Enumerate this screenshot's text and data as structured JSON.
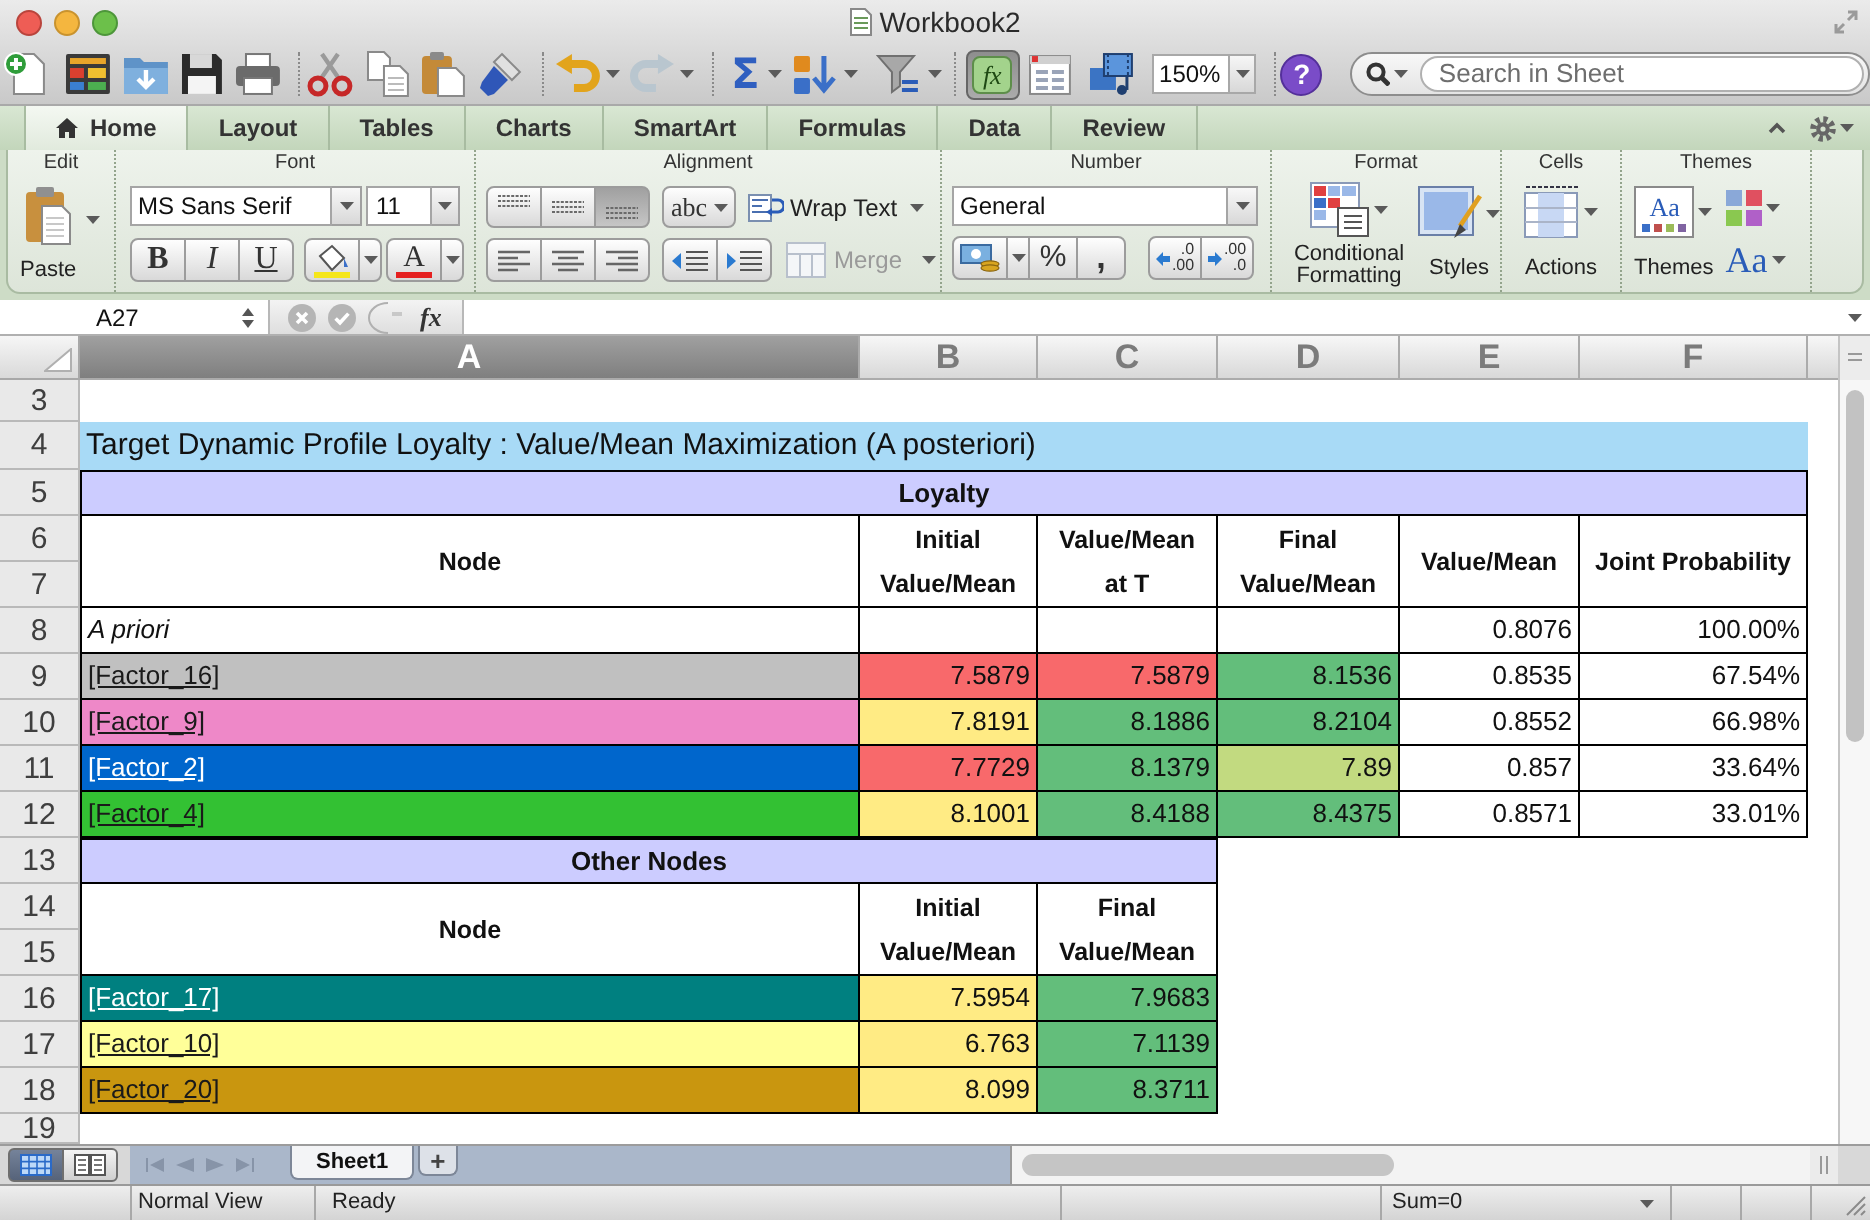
{
  "window": {
    "title": "Workbook2"
  },
  "toolbar": {
    "history": [
      {
        "kind": "undo",
        "disabled": false
      },
      {
        "kind": "redo",
        "disabled": true
      }
    ],
    "autosum": "Σ",
    "formula_builder": {
      "label": "fx",
      "selected": true
    },
    "zoom": "150%",
    "help": "?",
    "search": {
      "placeholder": "Search in Sheet"
    }
  },
  "tabs": [
    {
      "label": "Home",
      "selected": true
    },
    {
      "label": "Layout",
      "selected": false
    },
    {
      "label": "Tables",
      "selected": false
    },
    {
      "label": "Charts",
      "selected": false
    },
    {
      "label": "SmartArt",
      "selected": false
    },
    {
      "label": "Formulas",
      "selected": false
    },
    {
      "label": "Data",
      "selected": false
    },
    {
      "label": "Review",
      "selected": false
    }
  ],
  "ribbon": {
    "edit": {
      "title": "Edit",
      "paste": "Paste"
    },
    "font": {
      "title": "Font",
      "name": "MS Sans Serif",
      "size": "11",
      "styles": [
        {
          "kind": "bold",
          "label": "B"
        },
        {
          "kind": "italic",
          "label": "I"
        },
        {
          "kind": "underline",
          "label": "U"
        }
      ],
      "font_color": "A"
    },
    "alignment": {
      "title": "Alignment",
      "vertical": [
        {
          "kind": "top",
          "selected": false
        },
        {
          "kind": "middle",
          "selected": false
        },
        {
          "kind": "bottom",
          "selected": true
        }
      ],
      "horizontal": [
        {
          "kind": "left",
          "selected": false
        },
        {
          "kind": "center",
          "selected": false
        },
        {
          "kind": "right",
          "selected": false
        }
      ],
      "orientation": "abc",
      "wrap_text": "Wrap Text",
      "merge": {
        "label": "Merge",
        "disabled": true
      }
    },
    "number": {
      "title": "Number",
      "format": "General",
      "percent": "%",
      "comma": ",",
      "decimals": [
        {
          "kind": "increase",
          "top": ".0",
          "bottom": ".00"
        },
        {
          "kind": "decrease",
          "top": ".00",
          "bottom": ".0"
        }
      ]
    },
    "format": {
      "title": "Format",
      "conditional_formatting": "Conditional Formatting",
      "styles": "Styles"
    },
    "cells": {
      "title": "Cells",
      "actions": "Actions"
    },
    "themes": {
      "title": "Themes",
      "thumbnail": "Aa",
      "themes": "Themes",
      "fonts": "Aa"
    }
  },
  "formula_bar": {
    "name_box": "A27",
    "fx": "fx"
  },
  "sheet": {
    "columns": [
      {
        "label": "A",
        "selected": true
      },
      {
        "label": "B",
        "selected": false
      },
      {
        "label": "C",
        "selected": false
      },
      {
        "label": "D",
        "selected": false
      },
      {
        "label": "E",
        "selected": false
      },
      {
        "label": "F",
        "selected": false
      }
    ],
    "rows": [
      "3",
      "4",
      "5",
      "6",
      "7",
      "8",
      "9",
      "10",
      "11",
      "12",
      "13",
      "14",
      "15",
      "16",
      "17",
      "18",
      "19"
    ],
    "title": "Target Dynamic Profile Loyalty : Value/Mean Maximization (A posteriori)",
    "tables": [
      {
        "caption": "Loyalty",
        "headers": [
          "Node",
          "Initial Value/Mean",
          "Value/Mean at T",
          "Final Value/Mean",
          "Value/Mean",
          "Joint Probability"
        ],
        "rows": [
          {
            "kind": "prior",
            "node": "A priori",
            "values": [
              {
                "kind": "empty"
              },
              {
                "kind": "empty"
              },
              {
                "kind": "empty"
              },
              {
                "kind": "value",
                "text": "0.8076"
              },
              {
                "kind": "value",
                "text": "100.00%"
              }
            ]
          },
          {
            "kind": "node",
            "node": "[Factor_16]",
            "color": "#c0c0c0",
            "values": [
              {
                "kind": "value",
                "text": "7.5879",
                "color": "#f8696b"
              },
              {
                "kind": "value",
                "text": "7.5879",
                "color": "#f8696b"
              },
              {
                "kind": "value",
                "text": "8.1536",
                "color": "#63be7b"
              },
              {
                "kind": "value",
                "text": "0.8535"
              },
              {
                "kind": "value",
                "text": "67.54%"
              }
            ]
          },
          {
            "kind": "node",
            "node": "[Factor_9]",
            "color": "#ee88c8",
            "values": [
              {
                "kind": "value",
                "text": "7.8191",
                "color": "#ffeb84"
              },
              {
                "kind": "value",
                "text": "8.1886",
                "color": "#63be7b"
              },
              {
                "kind": "value",
                "text": "8.2104",
                "color": "#63be7b"
              },
              {
                "kind": "value",
                "text": "0.8552"
              },
              {
                "kind": "value",
                "text": "66.98%"
              }
            ]
          },
          {
            "kind": "node",
            "node": "[Factor_2]",
            "color": "#0066cc",
            "values": [
              {
                "kind": "value",
                "text": "7.7729",
                "color": "#f8696b"
              },
              {
                "kind": "value",
                "text": "8.1379",
                "color": "#63be7b"
              },
              {
                "kind": "value",
                "text": "7.89",
                "color": "#c2da80"
              },
              {
                "kind": "value",
                "text": "0.857"
              },
              {
                "kind": "value",
                "text": "33.64%"
              }
            ]
          },
          {
            "kind": "node",
            "node": "[Factor_4]",
            "color": "#33c133",
            "values": [
              {
                "kind": "value",
                "text": "8.1001",
                "color": "#ffeb84"
              },
              {
                "kind": "value",
                "text": "8.4188",
                "color": "#63be7b"
              },
              {
                "kind": "value",
                "text": "8.4375",
                "color": "#63be7b"
              },
              {
                "kind": "value",
                "text": "0.8571"
              },
              {
                "kind": "value",
                "text": "33.01%"
              }
            ]
          }
        ]
      },
      {
        "caption": "Other Nodes",
        "headers": [
          "Node",
          "Initial Value/Mean",
          "Final Value/Mean"
        ],
        "rows": [
          {
            "kind": "node",
            "node": "[Factor_17]",
            "color": "#008080",
            "values": [
              {
                "kind": "value",
                "text": "7.5954",
                "color": "#ffeb84"
              },
              {
                "kind": "value",
                "text": "7.9683",
                "color": "#63be7b"
              }
            ]
          },
          {
            "kind": "node",
            "node": "[Factor_10]",
            "color": "#ffff99",
            "values": [
              {
                "kind": "value",
                "text": "6.763",
                "color": "#ffeb84"
              },
              {
                "kind": "value",
                "text": "7.1139",
                "color": "#63be7b"
              }
            ]
          },
          {
            "kind": "node",
            "node": "[Factor_20]",
            "color": "#c9960f",
            "values": [
              {
                "kind": "value",
                "text": "8.099",
                "color": "#ffeb84"
              },
              {
                "kind": "value",
                "text": "8.3711",
                "color": "#63be7b"
              }
            ]
          }
        ]
      }
    ]
  },
  "view_buttons": [
    {
      "kind": "normal",
      "selected": true
    },
    {
      "kind": "page_layout",
      "selected": false
    }
  ],
  "sheet_tabs": [
    {
      "label": "Sheet1",
      "selected": true
    }
  ],
  "add_sheet": "+",
  "status_bar": {
    "view": "Normal View",
    "state": "Ready",
    "sum": "Sum=0"
  }
}
